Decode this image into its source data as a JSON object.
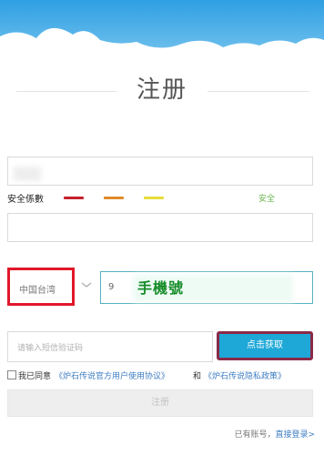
{
  "header": {
    "title": "注册"
  },
  "form": {
    "strength": {
      "label": "安全係數",
      "status": "安全",
      "colors": [
        "#c8202c",
        "#e08a2c",
        "#e6dd3a"
      ],
      "status_color": "#69b34c"
    },
    "region": {
      "value": "中国台湾"
    },
    "phone": {
      "prefix": "9",
      "overlay_label": "手機號"
    },
    "code": {
      "placeholder": "请输入短信验证码"
    },
    "get_code_label": "点击获取",
    "agree": {
      "prefix": "我已同意",
      "terms_link": "《炉石传说官方用户使用协议》",
      "conjunction": "和",
      "privacy_link": "《炉石传说隐私政策》"
    },
    "submit_label": "注册"
  },
  "footer": {
    "have_account": "已有账号，",
    "login_link": "直接登录>"
  },
  "colors": {
    "accent_blue": "#1ea8d8",
    "highlight_red": "#e1182a",
    "phone_green": "#178c2a"
  }
}
